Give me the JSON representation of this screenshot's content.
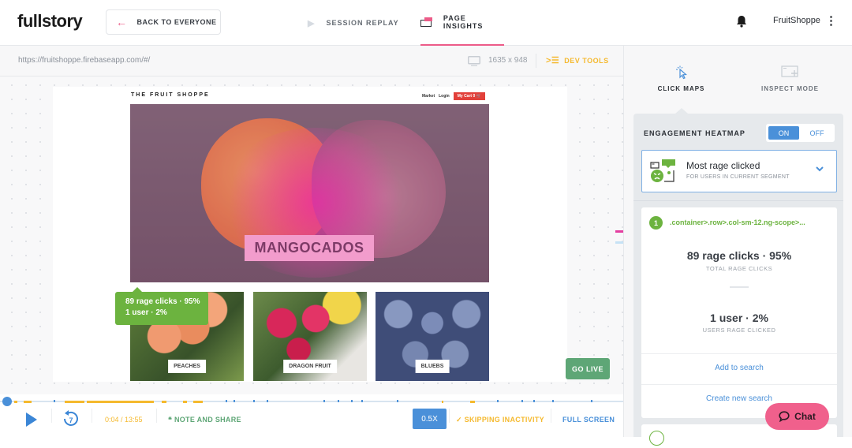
{
  "header": {
    "logo": "fullstory",
    "back_label": "BACK TO EVERYONE",
    "tabs": [
      {
        "label": "SESSION REPLAY",
        "active": false
      },
      {
        "label": "PAGE INSIGHTS",
        "active": true
      }
    ],
    "account": "FruitShoppe",
    "icons": {
      "back": "arrow-left-icon",
      "notifications": "bell-icon",
      "menu": "kebab-icon"
    }
  },
  "urlbar": {
    "url": "https://fruitshoppe.firebaseapp.com/#/",
    "resolution": "1635 x 948",
    "devtools_label": "DEV TOOLS"
  },
  "replay_page": {
    "site_title": "THE FRUIT SHOPPE",
    "nav": [
      "Market",
      "Login"
    ],
    "cart_label": "My Cart 0",
    "hero_label": "MANGOCADOS",
    "tiles": [
      "PEACHES",
      "DRAGON FRUIT",
      "BLUEBS"
    ],
    "tooltip": {
      "line1": "89 rage clicks · 95%",
      "line2": "1 user · 2%"
    },
    "go_live": "GO LIVE"
  },
  "playback": {
    "time": "0:04 / 13:55",
    "rewind_seconds": "7",
    "note_label": "NOTE AND SHARE",
    "speed": "0.5X",
    "skipping_label": "SKIPPING INACTIVITY",
    "fullscreen_label": "FULL SCREEN",
    "progress_fraction": 0.005
  },
  "sidebar": {
    "modes": [
      {
        "label": "CLICK MAPS",
        "active": true
      },
      {
        "label": "INSPECT MODE",
        "active": false
      }
    ],
    "heatmap_title": "ENGAGEMENT HEATMAP",
    "toggle": {
      "on": "ON",
      "off": "OFF",
      "value": "ON"
    },
    "metric": {
      "main": "Most rage clicked",
      "sub": "FOR USERS IN CURRENT SEGMENT"
    },
    "results": [
      {
        "rank": "1",
        "selector": ".container>.row>.col-sm-12.ng-scope>...",
        "stat1": "89 rage clicks · 95%",
        "stat1_label": "TOTAL RAGE CLICKS",
        "stat2": "1 user · 2%",
        "stat2_label": "USERS RAGE CLICKED",
        "actions": [
          "Add to search",
          "Create new search"
        ]
      }
    ]
  },
  "chat": {
    "label": "Chat"
  },
  "colors": {
    "accent_pink": "#ec5b88",
    "blue": "#4a90d9",
    "green": "#6cb33f",
    "amber": "#f5b92e",
    "go_live": "#5ea676"
  }
}
